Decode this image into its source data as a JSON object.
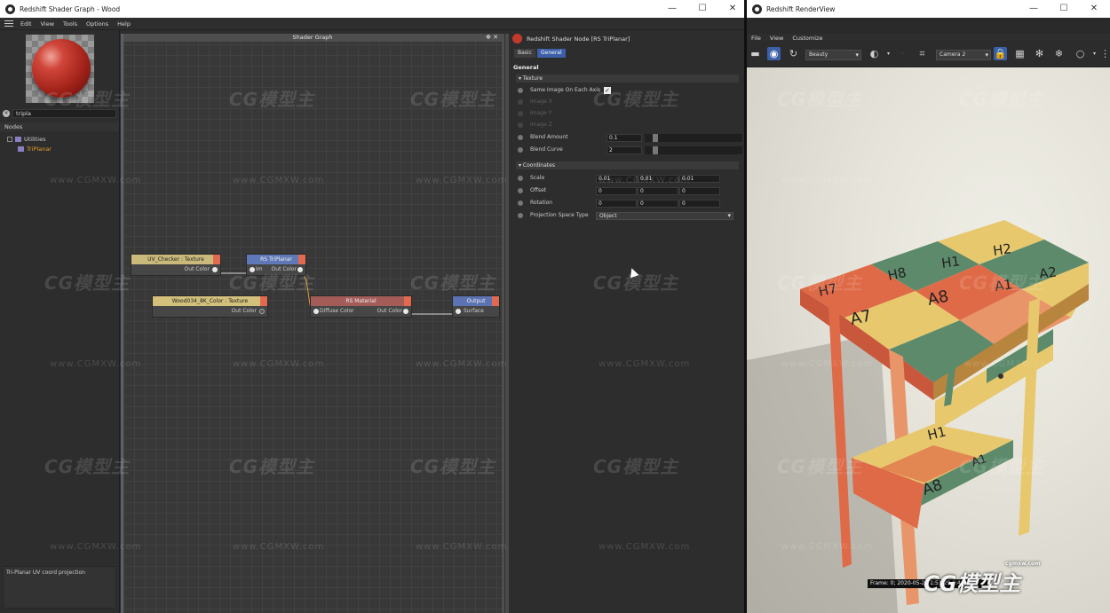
{
  "shader_window": {
    "title": "Redshift Shader Graph - Wood",
    "menu": [
      "Edit",
      "View",
      "Tools",
      "Options",
      "Help"
    ],
    "search_value": "tripla",
    "nodes_header": "Nodes",
    "tree": {
      "folder": "Utilities",
      "item": "TriPlanar"
    },
    "description": "Tri-Planar UV coord projection",
    "graph_title": "Shader Graph",
    "nodes": {
      "uv_checker": {
        "title": "UV_Checker : Texture",
        "port": "Out Color"
      },
      "wood": {
        "title": "Wood034_8K_Color : Texture",
        "port": "Out Color"
      },
      "triplanar": {
        "title": "RS TriPlanar",
        "port_in": "Im",
        "port_out": "Out Color"
      },
      "rs_material": {
        "title": "RS Material",
        "port_in": "Diffuse Color",
        "port_out": "Out Color"
      },
      "output": {
        "title": "Output",
        "port_in": "Surface"
      }
    },
    "attributes": {
      "title": "Redshift Shader Node [RS TriPlanar]",
      "tabs": [
        "Basic",
        "General"
      ],
      "section": "General",
      "group_texture": "Texture",
      "same_image_label": "Same Image On Each Axis",
      "same_image_checked": true,
      "image_x": "Image X",
      "image_y": "Image Y",
      "image_z": "Image Z",
      "blend_amount_label": "Blend Amount",
      "blend_amount": "0.1",
      "blend_curve_label": "Blend Curve",
      "blend_curve": "2",
      "group_coordinates": "Coordinates",
      "scale_label": "Scale",
      "scale": [
        "0.01",
        "0.01",
        "0.01"
      ],
      "offset_label": "Offset",
      "offset": [
        "0",
        "0",
        "0"
      ],
      "rotation_label": "Rotation",
      "rotation": [
        "0",
        "0",
        "0"
      ],
      "projection_label": "Projection Space Type",
      "projection_value": "Object"
    }
  },
  "render_window": {
    "title": "Redshift RenderView",
    "menu": [
      "File",
      "View",
      "Customize"
    ],
    "aov": "Beauty",
    "camera": "Camera 2",
    "frame_info": "Frame: 0;  2020-05-20  1:51:29  0:44:62"
  },
  "table_labels": {
    "top": [
      "H7",
      "H8",
      "H1",
      "H2",
      "A7",
      "A8",
      "A2",
      "A1"
    ],
    "shelf": [
      "H1",
      "A8",
      "A1"
    ]
  },
  "colors": {
    "accent_blue": "#3c5fa8",
    "node_texture": "#d2c07b",
    "node_triplanar": "#5f78b8",
    "node_material": "#a35c58",
    "checker_red": "#df6a47",
    "checker_green": "#5d8a6a",
    "checker_yellow": "#e8c86d",
    "checker_salmon": "#e8956a"
  },
  "watermark": {
    "logo": "CG模型主",
    "url": "www.CGMXW.com",
    "corner_url": "cgmxw.com"
  },
  "icons": [
    "hamburger-icon",
    "close-icon",
    "search-clear-icon",
    "redshift-node-icon",
    "checkbox-icon",
    "folder-icon",
    "camera-icon",
    "refresh-icon",
    "crop-icon",
    "lock-icon",
    "grid-icon",
    "snowflake-icon",
    "sphere-icon"
  ]
}
